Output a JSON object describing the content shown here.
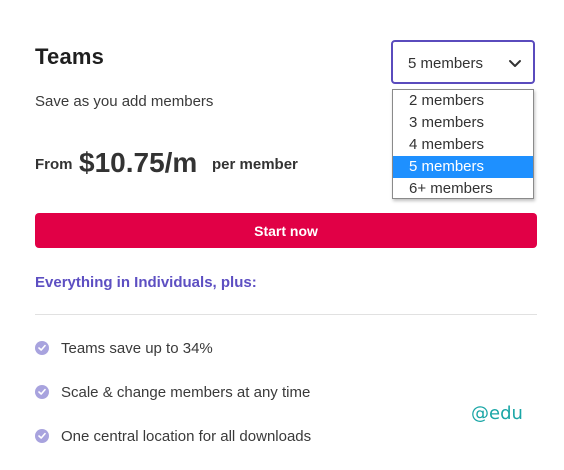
{
  "plan": {
    "title": "Teams",
    "subtitle": "Save as you add members"
  },
  "member_select": {
    "value": "5 members",
    "options": [
      "2 members",
      "3 members",
      "4 members",
      "5 members",
      "6+ members"
    ],
    "selected_index": 3
  },
  "price": {
    "from_label": "From",
    "amount": "$10.75/m",
    "per_label": "per member"
  },
  "cta": {
    "label": "Start now",
    "color": "#e10046"
  },
  "features_heading": "Everything in Individuals, plus:",
  "features": [
    "Teams save up to 34%",
    "Scale & change members at any time",
    "One central location for all downloads"
  ],
  "watermark": "@edu",
  "colors": {
    "accent": "#5d4fc2",
    "select_border": "#5a4bbd",
    "highlight": "#1e90ff",
    "check": "#a8a3de"
  }
}
